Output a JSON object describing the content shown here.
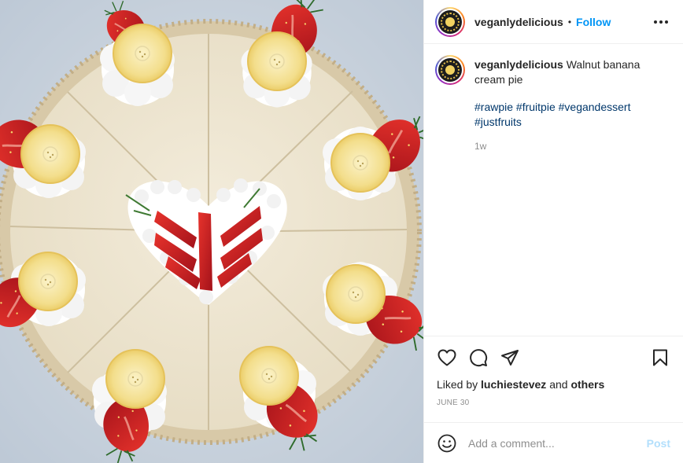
{
  "post": {
    "photo_alt": "Walnut banana cream pie"
  },
  "header": {
    "username": "veganlydelicious",
    "separator": "•",
    "follow_label": "Follow",
    "more_icon": "more-horizontal-icon"
  },
  "caption": {
    "username": "veganlydelicious",
    "text": "Walnut banana cream pie",
    "hashtags": [
      "#rawpie",
      "#fruitpie",
      "#vegandessert",
      "#justfruits"
    ],
    "age": "1w"
  },
  "actions": {
    "icons": [
      "heart-icon",
      "comment-icon",
      "share-icon",
      "bookmark-icon"
    ],
    "liked_prefix": "Liked by",
    "liked_user": "luchiestevez",
    "liked_and": "and",
    "liked_others": "others",
    "date": "June 30"
  },
  "comment": {
    "placeholder": "Add a comment...",
    "post_label": "Post"
  },
  "colors": {
    "link": "#0095f6",
    "hashtag": "#00376b",
    "muted": "#8e8e8e",
    "post_disabled": "#b2dffc"
  }
}
